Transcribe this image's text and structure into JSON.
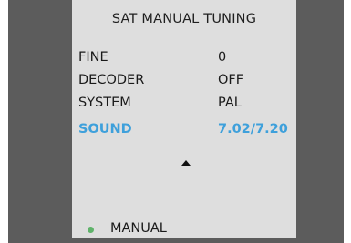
{
  "menu": {
    "title": "SAT MANUAL TUNING",
    "rows": [
      {
        "label": "FINE",
        "value": "0",
        "selected": false
      },
      {
        "label": "DECODER",
        "value": "OFF",
        "selected": false
      },
      {
        "label": "SYSTEM",
        "value": "PAL",
        "selected": false
      },
      {
        "label": "SOUND",
        "value": "7.02/7.20",
        "selected": true
      }
    ],
    "scroll_icon": "up-arrow-icon",
    "status": {
      "label": "MANUAL",
      "indicator_color": "#5fb36a"
    }
  },
  "colors": {
    "panel": "#dedede",
    "sidebar": "#5c5c5c",
    "highlight": "#3ea0db",
    "text": "#1a1a1a"
  }
}
